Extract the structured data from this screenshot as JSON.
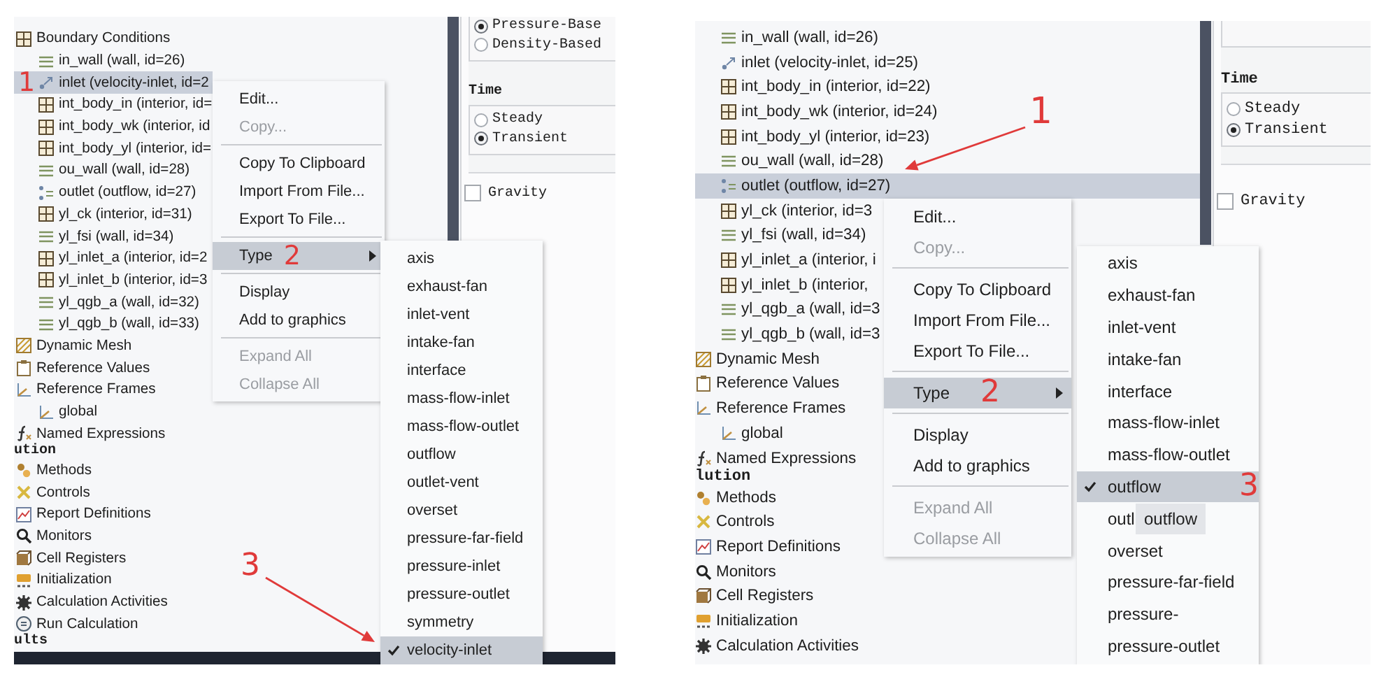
{
  "screenshots": [
    {
      "tree": {
        "items": [
          {
            "label": "Boundary Conditions",
            "kind": "grid",
            "selected": false,
            "children": [
              {
                "label": "in_wall (wall, id=26)",
                "kind": "wall",
                "selected": false
              },
              {
                "label": "inlet (velocity-inlet, id=2",
                "kind": "flow-in",
                "selected": true,
                "annotation": {
                  "label": "1",
                  "arrow": false
                }
              },
              {
                "label": "int_body_in (interior, id=",
                "kind": "grid",
                "selected": false
              },
              {
                "label": "int_body_wk (interior, id",
                "kind": "grid",
                "selected": false
              },
              {
                "label": "int_body_yl (interior, id=",
                "kind": "grid",
                "selected": false
              },
              {
                "label": "ou_wall (wall, id=28)",
                "kind": "wall",
                "selected": false
              },
              {
                "label": "outlet (outflow, id=27)",
                "kind": "flow-out",
                "selected": false
              },
              {
                "label": "yl_ck (interior, id=31)",
                "kind": "grid",
                "selected": false
              },
              {
                "label": "yl_fsi (wall, id=34)",
                "kind": "wall",
                "selected": false
              },
              {
                "label": "yl_inlet_a (interior, id=2",
                "kind": "grid",
                "selected": false
              },
              {
                "label": "yl_inlet_b (interior, id=3",
                "kind": "grid",
                "selected": false
              },
              {
                "label": "yl_qgb_a (wall, id=32)",
                "kind": "wall",
                "selected": false
              },
              {
                "label": "yl_qgb_b (wall, id=33)",
                "kind": "wall",
                "selected": false
              }
            ]
          },
          {
            "label": "Dynamic Mesh",
            "kind": "mesh",
            "selected": false
          },
          {
            "label": "Reference Values",
            "kind": "values",
            "selected": false
          },
          {
            "label": "Reference Frames",
            "kind": "frames",
            "selected": false,
            "children": [
              {
                "label": "global",
                "kind": "frames",
                "selected": false
              }
            ]
          },
          {
            "label": "Named Expressions",
            "kind": "expr",
            "selected": false
          },
          {
            "label": "ution",
            "kind": "section"
          },
          {
            "label": "Methods",
            "kind": "methods",
            "selected": false
          },
          {
            "label": "Controls",
            "kind": "controls",
            "selected": false
          },
          {
            "label": "Report Definitions",
            "kind": "report",
            "selected": false
          },
          {
            "label": "Monitors",
            "kind": "monitors",
            "selected": false
          },
          {
            "label": "Cell Registers",
            "kind": "registers",
            "selected": false
          },
          {
            "label": "Initialization",
            "kind": "init",
            "selected": false
          },
          {
            "label": "Calculation Activities",
            "kind": "activities",
            "selected": false
          },
          {
            "label": "Run Calculation",
            "kind": "run",
            "selected": false
          },
          {
            "label": "ults",
            "kind": "section"
          }
        ]
      },
      "context_menu": {
        "items": [
          {
            "label": "Edit...",
            "disabled": false,
            "selected": false
          },
          {
            "label": "Copy...",
            "disabled": true,
            "selected": false
          },
          {
            "kind": "separator"
          },
          {
            "label": "Copy To Clipboard",
            "disabled": false,
            "selected": false
          },
          {
            "label": "Import From File...",
            "disabled": false,
            "selected": false
          },
          {
            "label": "Export To File...",
            "disabled": false,
            "selected": false
          },
          {
            "kind": "separator"
          },
          {
            "label": "Type",
            "disabled": false,
            "selected": true,
            "submenu": true,
            "annotation": {
              "label": "2",
              "arrow": false
            }
          },
          {
            "kind": "separator"
          },
          {
            "label": "Display",
            "disabled": false,
            "selected": false
          },
          {
            "label": "Add to graphics",
            "disabled": false,
            "selected": false
          },
          {
            "kind": "separator"
          },
          {
            "label": "Expand All",
            "disabled": true,
            "selected": false
          },
          {
            "label": "Collapse All",
            "disabled": true,
            "selected": false
          }
        ]
      },
      "type_submenu": {
        "items": [
          {
            "label": "axis",
            "checked": false,
            "selected": false
          },
          {
            "label": "exhaust-fan",
            "checked": false,
            "selected": false
          },
          {
            "label": "inlet-vent",
            "checked": false,
            "selected": false
          },
          {
            "label": "intake-fan",
            "checked": false,
            "selected": false
          },
          {
            "label": "interface",
            "checked": false,
            "selected": false
          },
          {
            "label": "mass-flow-inlet",
            "checked": false,
            "selected": false
          },
          {
            "label": "mass-flow-outlet",
            "checked": false,
            "selected": false
          },
          {
            "label": "outflow",
            "checked": false,
            "selected": false
          },
          {
            "label": "outlet-vent",
            "checked": false,
            "selected": false
          },
          {
            "label": "overset",
            "checked": false,
            "selected": false
          },
          {
            "label": "pressure-far-field",
            "checked": false,
            "selected": false
          },
          {
            "label": "pressure-inlet",
            "checked": false,
            "selected": false
          },
          {
            "label": "pressure-outlet",
            "checked": false,
            "selected": false
          },
          {
            "label": "symmetry",
            "checked": false,
            "selected": false
          },
          {
            "label": "velocity-inlet",
            "checked": true,
            "selected": true,
            "annotation": {
              "label": "3",
              "arrow": true
            }
          }
        ]
      },
      "settings": {
        "solver_options": [
          {
            "label": "Pressure-Base",
            "selected": true
          },
          {
            "label": "Density-Based",
            "selected": false
          }
        ],
        "time_title": "Time",
        "time_options": [
          {
            "label": "Steady",
            "selected": false
          },
          {
            "label": "Transient",
            "selected": true
          }
        ],
        "gravity": {
          "label": "Gravity",
          "checked": false
        }
      },
      "taskbar": true
    },
    {
      "tree": {
        "items": [
          {
            "kind": "continued",
            "children": [
              {
                "label": "in_wall (wall, id=26)",
                "kind": "wall",
                "selected": false
              },
              {
                "label": "inlet (velocity-inlet, id=25)",
                "kind": "flow-in",
                "selected": false
              },
              {
                "label": "int_body_in (interior, id=22)",
                "kind": "grid",
                "selected": false
              },
              {
                "label": "int_body_wk (interior, id=24)",
                "kind": "grid",
                "selected": false
              },
              {
                "label": "int_body_yl (interior, id=23)",
                "kind": "grid",
                "selected": false
              },
              {
                "label": "ou_wall (wall, id=28)",
                "kind": "wall",
                "selected": false
              },
              {
                "label": "outlet (outflow, id=27)",
                "kind": "flow-out",
                "selected": true,
                "annotation": {
                  "label": "1",
                  "arrow": true
                }
              },
              {
                "label": "yl_ck (interior, id=3",
                "kind": "grid",
                "selected": false
              },
              {
                "label": "yl_fsi (wall, id=34)",
                "kind": "wall",
                "selected": false
              },
              {
                "label": "yl_inlet_a (interior, i",
                "kind": "grid",
                "selected": false
              },
              {
                "label": "yl_inlet_b (interior,",
                "kind": "grid",
                "selected": false
              },
              {
                "label": "yl_qgb_a (wall, id=3",
                "kind": "wall",
                "selected": false
              },
              {
                "label": "yl_qgb_b (wall, id=3",
                "kind": "wall",
                "selected": false
              }
            ]
          },
          {
            "label": "Dynamic Mesh",
            "kind": "mesh",
            "selected": false
          },
          {
            "label": "Reference Values",
            "kind": "values",
            "selected": false
          },
          {
            "label": "Reference Frames",
            "kind": "frames",
            "selected": false,
            "children": [
              {
                "label": "global",
                "kind": "frames",
                "selected": false
              }
            ]
          },
          {
            "label": "Named Expressions",
            "kind": "expr",
            "selected": false
          },
          {
            "label": "lution",
            "kind": "section"
          },
          {
            "label": "Methods",
            "kind": "methods",
            "selected": false
          },
          {
            "label": "Controls",
            "kind": "controls",
            "selected": false
          },
          {
            "label": "Report Definitions",
            "kind": "report",
            "selected": false
          },
          {
            "label": "Monitors",
            "kind": "monitors",
            "selected": false
          },
          {
            "label": "Cell Registers",
            "kind": "registers",
            "selected": false
          },
          {
            "label": "Initialization",
            "kind": "init",
            "selected": false
          },
          {
            "label": "Calculation Activities",
            "kind": "activities",
            "selected": false
          }
        ]
      },
      "context_menu": {
        "items": [
          {
            "label": "Edit...",
            "disabled": false,
            "selected": false
          },
          {
            "label": "Copy...",
            "disabled": true,
            "selected": false
          },
          {
            "kind": "separator"
          },
          {
            "label": "Copy To Clipboard",
            "disabled": false,
            "selected": false
          },
          {
            "label": "Import From File...",
            "disabled": false,
            "selected": false
          },
          {
            "label": "Export To File...",
            "disabled": false,
            "selected": false
          },
          {
            "kind": "separator"
          },
          {
            "label": "Type",
            "disabled": false,
            "selected": true,
            "submenu": true,
            "annotation": {
              "label": "2",
              "arrow": false
            }
          },
          {
            "kind": "separator"
          },
          {
            "label": "Display",
            "disabled": false,
            "selected": false
          },
          {
            "label": "Add to graphics",
            "disabled": false,
            "selected": false
          },
          {
            "kind": "separator"
          },
          {
            "label": "Expand All",
            "disabled": true,
            "selected": false
          },
          {
            "label": "Collapse All",
            "disabled": true,
            "selected": false
          }
        ]
      },
      "type_submenu": {
        "items": [
          {
            "label": "axis",
            "checked": false,
            "selected": false
          },
          {
            "label": "exhaust-fan",
            "checked": false,
            "selected": false
          },
          {
            "label": "inlet-vent",
            "checked": false,
            "selected": false
          },
          {
            "label": "intake-fan",
            "checked": false,
            "selected": false
          },
          {
            "label": "interface",
            "checked": false,
            "selected": false
          },
          {
            "label": "mass-flow-inlet",
            "checked": false,
            "selected": false
          },
          {
            "label": "mass-flow-outlet",
            "checked": false,
            "selected": false
          },
          {
            "label": "outflow",
            "checked": true,
            "selected": true,
            "annotation": {
              "label": "3",
              "arrow": false
            }
          },
          {
            "label": "outl",
            "checked": false,
            "selected": false,
            "tooltip": "outflow"
          },
          {
            "label": "overset",
            "checked": false,
            "selected": false
          },
          {
            "label": "pressure-far-field",
            "checked": false,
            "selected": false
          },
          {
            "label": "pressure-",
            "checked": false,
            "selected": false
          },
          {
            "label": "pressure-outlet",
            "checked": false,
            "selected": false
          }
        ]
      },
      "settings": {
        "time_title": "Time",
        "time_options": [
          {
            "label": "Steady",
            "selected": false
          },
          {
            "label": "Transient",
            "selected": true
          }
        ],
        "gravity": {
          "label": "Gravity",
          "checked": false
        }
      }
    }
  ]
}
